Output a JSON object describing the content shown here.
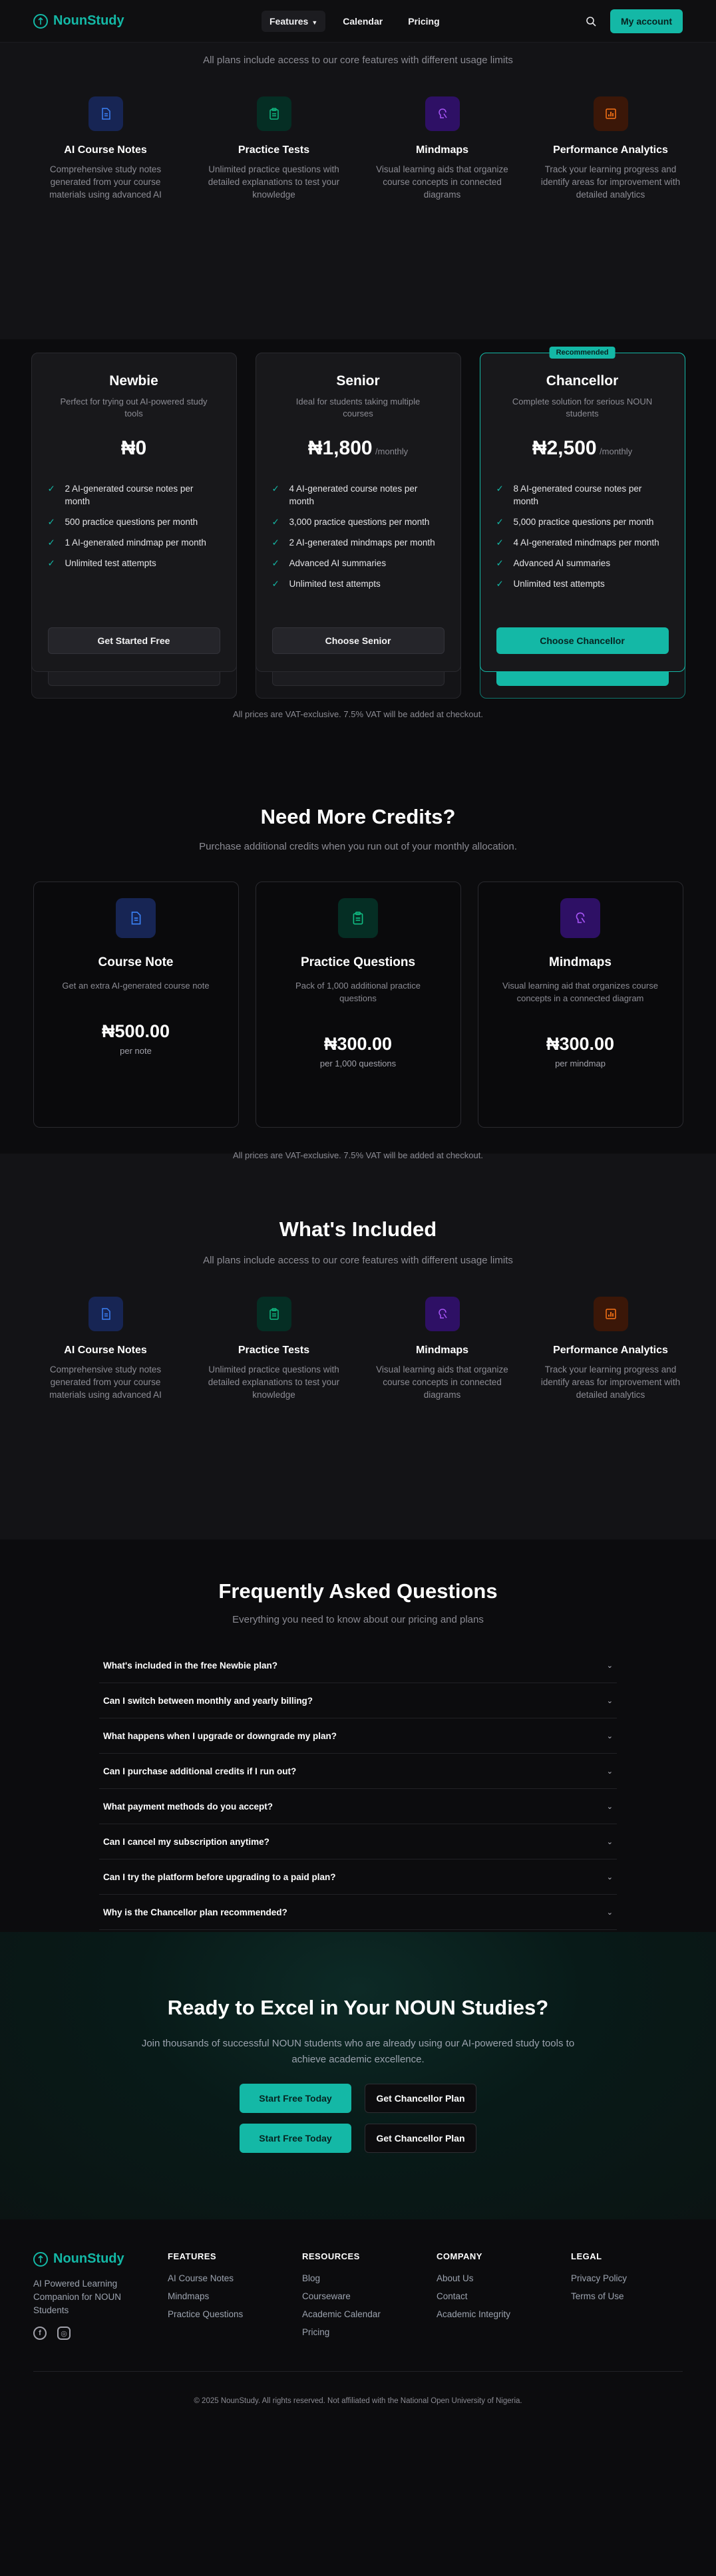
{
  "nav": {
    "brand": "NounStudy",
    "links": [
      "Features",
      "Calendar",
      "Pricing"
    ],
    "account_button": "My account"
  },
  "colors": {
    "accent": "#14b8a6",
    "blue": "#3b82f6",
    "green": "#10b981",
    "purple": "#a855f7",
    "orange": "#f97316"
  },
  "features_intro": "All plans include access to our core features with different usage limits",
  "features": [
    {
      "title": "AI Course Notes",
      "text": "Comprehensive study notes generated from your course materials using advanced AI",
      "icon": "document-icon"
    },
    {
      "title": "Practice Tests",
      "text": "Unlimited practice questions with detailed explanations to test your knowledge",
      "icon": "clipboard-icon"
    },
    {
      "title": "Mindmaps",
      "text": "Visual learning aids that organize course concepts in connected diagrams",
      "icon": "brain-icon"
    },
    {
      "title": "Performance Analytics",
      "text": "Track your learning progress and identify areas for improvement with detailed analytics",
      "icon": "bar-chart-icon"
    }
  ],
  "plans": [
    {
      "name": "Newbie",
      "desc": "Perfect for trying out AI-powered study tools",
      "price": "₦0",
      "period": "",
      "features": [
        "2 AI-generated course notes per month",
        "500 practice questions per month",
        "1 AI-generated mindmap per month",
        "Unlimited test attempts"
      ],
      "button": "Get Started Free"
    },
    {
      "name": "Senior",
      "desc": "Ideal for students taking multiple courses",
      "price": "₦1,800",
      "period": "/monthly",
      "features": [
        "4 AI-generated course notes per month",
        "3,000 practice questions per month",
        "2 AI-generated mindmaps per month",
        "Advanced AI summaries",
        "Unlimited test attempts"
      ],
      "button": "Choose Senior"
    },
    {
      "name": "Chancellor",
      "desc": "Complete solution for serious NOUN students",
      "price": "₦2,500",
      "period": "/monthly",
      "badge": "Recommended",
      "features": [
        "8 AI-generated course notes per month",
        "5,000 practice questions per month",
        "4 AI-generated mindmaps per month",
        "Advanced AI summaries",
        "Unlimited test attempts"
      ],
      "button": "Choose Chancellor"
    }
  ],
  "vat_note": "All prices are VAT-exclusive. 7.5% VAT will be added at checkout.",
  "credits": {
    "title": "Need More Credits?",
    "subtitle": "Purchase additional credits when you run out of your monthly allocation.",
    "items": [
      {
        "title": "Course Note",
        "desc": "Get an extra AI-generated course note",
        "price": "₦500.00",
        "unit": "per note",
        "icon": "document-icon"
      },
      {
        "title": "Practice Questions",
        "desc": "Pack of 1,000 additional practice questions",
        "price": "₦300.00",
        "unit": "per 1,000 questions",
        "icon": "clipboard-icon"
      },
      {
        "title": "Mindmaps",
        "desc": "Visual learning aid that organizes course concepts in a connected diagram",
        "price": "₦300.00",
        "unit": "per mindmap",
        "icon": "brain-icon"
      }
    ]
  },
  "included": {
    "title": "What's Included"
  },
  "faq": {
    "title": "Frequently Asked Questions",
    "subtitle": "Everything you need to know about our pricing and plans",
    "items": [
      "What's included in the free Newbie plan?",
      "Can I switch between monthly and yearly billing?",
      "What happens when I upgrade or downgrade my plan?",
      "Can I purchase additional credits if I run out?",
      "What payment methods do you accept?",
      "Can I cancel my subscription anytime?",
      "Can I try the platform before upgrading to a paid plan?",
      "Why is the Chancellor plan recommended?"
    ]
  },
  "cta": {
    "title": "Ready to Excel in Your NOUN Studies?",
    "text": "Join thousands of successful NOUN students who are already using our AI-powered study tools to achieve academic excellence.",
    "primary": "Start Free Today",
    "secondary": "Get Chancellor Plan"
  },
  "footer": {
    "brand": "NounStudy",
    "tagline": "AI Powered Learning Companion for NOUN Students",
    "columns": [
      {
        "title": "FEATURES",
        "links": [
          "AI Course Notes",
          "Mindmaps",
          "Practice Questions"
        ]
      },
      {
        "title": "RESOURCES",
        "links": [
          "Blog",
          "Courseware",
          "Academic Calendar",
          "Pricing"
        ]
      },
      {
        "title": "COMPANY",
        "links": [
          "About Us",
          "Contact",
          "Academic Integrity"
        ]
      },
      {
        "title": "LEGAL",
        "links": [
          "Privacy Policy",
          "Terms of Use"
        ]
      }
    ],
    "copyright": "© 2025 NounStudy. All rights reserved. Not affiliated with the National Open University of Nigeria."
  }
}
